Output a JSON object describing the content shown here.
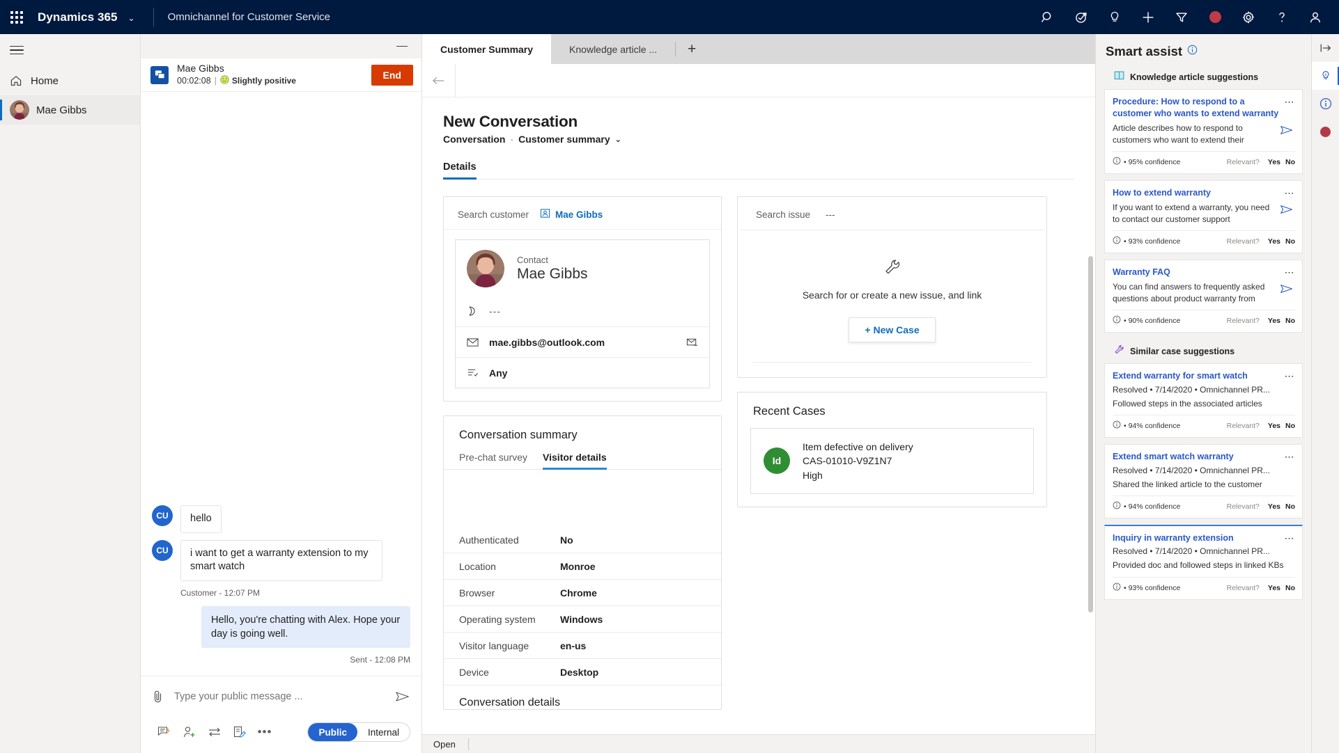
{
  "topnav": {
    "waffle_label": "app-launcher",
    "brand": "Dynamics 365",
    "brand_caret": "⌄",
    "app_name": "Omnichannel for Customer Service",
    "icons": [
      {
        "name": "search-icon",
        "label": "Search"
      },
      {
        "name": "diagnostics-icon",
        "label": "Diagnostics"
      },
      {
        "name": "lightbulb-icon",
        "label": "Assist"
      },
      {
        "name": "plus-icon",
        "label": "New"
      },
      {
        "name": "filter-icon",
        "label": "Filter"
      },
      {
        "name": "presence-icon",
        "label": "Presence",
        "color": "#c03b47"
      },
      {
        "name": "gear-icon",
        "label": "Settings"
      },
      {
        "name": "help-icon",
        "label": "Help"
      },
      {
        "name": "user-icon",
        "label": "Account"
      }
    ]
  },
  "leftrail": {
    "menu_label": "Site map",
    "items": [
      {
        "label": "Home",
        "icon": "home-icon",
        "selected": false
      },
      {
        "label": "Mae Gibbs",
        "icon": "avatar",
        "selected": true
      }
    ]
  },
  "conversation": {
    "minimize_label": "Minimize",
    "customer_name": "Mae Gibbs",
    "timer": "00:02:08",
    "separator": "|",
    "sentiment": "Slightly positive",
    "end_button": "End",
    "messages": [
      {
        "from": "customer",
        "initials": "CU",
        "text": "hello"
      },
      {
        "from": "customer",
        "initials": "CU",
        "text": "i want to get a warranty extension to my smart watch"
      }
    ],
    "customer_meta": "Customer - 12:07 PM",
    "agent_message": "Hello, you're chatting with Alex. Hope your day is going well.",
    "agent_meta": "Sent - 12:08 PM",
    "composer": {
      "placeholder": "Type your public message ...",
      "value": "",
      "attach_label": "Attach file",
      "send_label": "Send",
      "tools": [
        {
          "name": "quick-replies-icon",
          "label": "Quick replies"
        },
        {
          "name": "consult-icon",
          "label": "Consult"
        },
        {
          "name": "transfer-icon",
          "label": "Transfer"
        },
        {
          "name": "notes-icon",
          "label": "Notes"
        },
        {
          "name": "more-icon",
          "label": "•••"
        }
      ],
      "mode_public": "Public",
      "mode_internal": "Internal"
    }
  },
  "main": {
    "tabs": [
      {
        "label": "Customer Summary",
        "active": true
      },
      {
        "label": "Knowledge article ...",
        "active": false
      }
    ],
    "tab_add_label": "+",
    "back_label": "Back",
    "record_title": "New Conversation",
    "breadcrumb_entity": "Conversation",
    "breadcrumb_sep": "·",
    "breadcrumb_form": "Customer summary",
    "breadcrumb_caret": "⌄",
    "form_tabs": [
      {
        "label": "Details",
        "active": true
      }
    ],
    "search_customer": {
      "label": "Search customer",
      "chip_name": "Mae Gibbs",
      "contact_role": "Contact",
      "contact_name": "Mae Gibbs",
      "rows": [
        {
          "icon": "phone-icon",
          "value": "---",
          "muted": true,
          "trailing": null
        },
        {
          "icon": "email-icon",
          "value": "mae.gibbs@outlook.com",
          "muted": false,
          "trailing": "send-email-icon"
        },
        {
          "icon": "preference-icon",
          "value": "Any",
          "muted": false,
          "trailing": null
        }
      ]
    },
    "search_issue": {
      "label": "Search issue",
      "value": "---",
      "empty_icon": "wrench-icon",
      "empty_text": "Search for or create a new issue, and link",
      "new_case_button": "+ New Case"
    },
    "conversation_summary": {
      "title": "Conversation summary",
      "tabs": [
        {
          "label": "Pre-chat survey",
          "active": false
        },
        {
          "label": "Visitor details",
          "active": true
        }
      ],
      "rows": [
        {
          "key": "Authenticated",
          "value": "No"
        },
        {
          "key": "Location",
          "value": "Monroe"
        },
        {
          "key": "Browser",
          "value": "Chrome"
        },
        {
          "key": "Operating system",
          "value": "Windows"
        },
        {
          "key": "Visitor language",
          "value": "en-us"
        },
        {
          "key": "Device",
          "value": "Desktop"
        }
      ],
      "next_section": "Conversation details"
    },
    "recent_cases": {
      "title": "Recent Cases",
      "items": [
        {
          "badge": "Id",
          "title": "Item defective on delivery",
          "number": "CAS-01010-V9Z1N7",
          "priority": "High"
        }
      ]
    },
    "statusbar": {
      "text": "Open"
    }
  },
  "smart_assist": {
    "title": "Smart assist",
    "info_icon": "info-icon",
    "groups": [
      {
        "icon": "knowledge-icon",
        "label": "Knowledge article suggestions",
        "cards": [
          {
            "title": "Procedure: How to respond to a customer who wants to extend warranty",
            "desc": "Article describes how to respond to customers who want to extend their",
            "meta": null,
            "confidence": "95% confidence",
            "relevant_label": "Relevant?",
            "yes": "Yes",
            "no": "No",
            "highlight": false
          },
          {
            "title": "How to extend warranty",
            "desc": "If you want to extend a warranty, you need to contact our customer support",
            "meta": null,
            "confidence": "93% confidence",
            "relevant_label": "Relevant?",
            "yes": "Yes",
            "no": "No",
            "highlight": false
          },
          {
            "title": "Warranty FAQ",
            "desc": "You can find answers to frequently asked questions about product warranty from",
            "meta": null,
            "confidence": "90% confidence",
            "relevant_label": "Relevant?",
            "yes": "Yes",
            "no": "No",
            "highlight": false
          }
        ]
      },
      {
        "icon": "similar-case-icon",
        "label": "Similar case suggestions",
        "cards": [
          {
            "title": "Extend warranty for smart watch",
            "meta": "Resolved • 7/14/2020 • Omnichannel PR...",
            "desc": "Followed steps in the associated articles",
            "confidence": "94% confidence",
            "relevant_label": "Relevant?",
            "yes": "Yes",
            "no": "No",
            "highlight": false
          },
          {
            "title": "Extend smart watch warranty",
            "meta": "Resolved • 7/14/2020 • Omnichannel PR...",
            "desc": "Shared the linked article to the customer",
            "confidence": "94% confidence",
            "relevant_label": "Relevant?",
            "yes": "Yes",
            "no": "No",
            "highlight": false
          },
          {
            "title": "Inquiry in warranty extension",
            "meta": "Resolved • 7/14/2020 • Omnichannel PR...",
            "desc": "Provided doc and followed steps in linked KBs",
            "confidence": "93% confidence",
            "relevant_label": "Relevant?",
            "yes": "Yes",
            "no": "No",
            "highlight": true
          }
        ]
      }
    ]
  },
  "farrail": {
    "items": [
      {
        "name": "expand-panel-icon",
        "selected": false
      },
      {
        "name": "lightbulb-icon",
        "selected": true
      },
      {
        "name": "info-icon",
        "selected": false
      },
      {
        "name": "presence-icon",
        "selected": false
      }
    ]
  },
  "colors": {
    "brand_navy": "#00193f",
    "accent_blue": "#0f6cbd",
    "link_blue": "#2b58c7",
    "end_orange": "#d83b01",
    "case_green": "#2f8e33",
    "presence_red": "#c03b47"
  }
}
